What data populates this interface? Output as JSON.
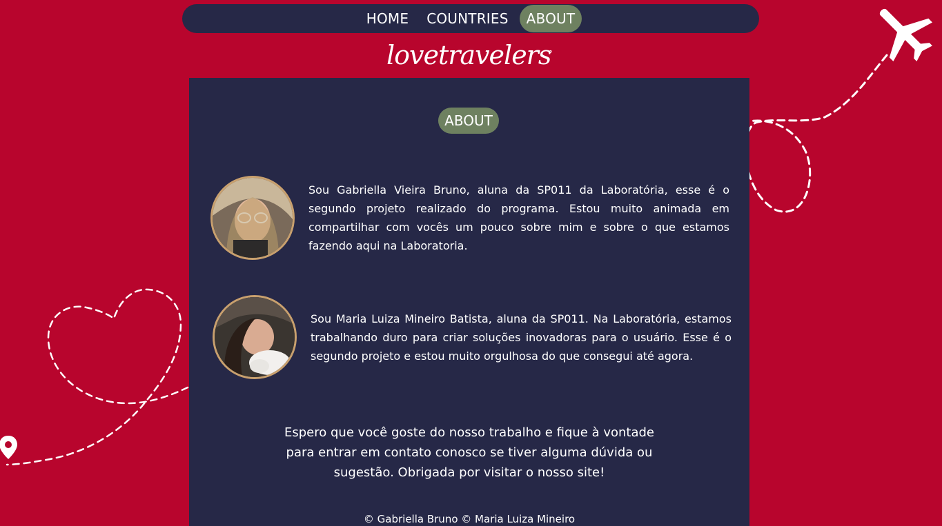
{
  "nav": {
    "items": [
      {
        "label": "HOME",
        "active": false
      },
      {
        "label": "COUNTRIES",
        "active": false
      },
      {
        "label": "ABOUT",
        "active": true
      }
    ]
  },
  "logo": {
    "text": "lovetravelers",
    "icon": "map-pin-plane-icon"
  },
  "about": {
    "title": "ABOUT",
    "profiles": [
      {
        "avatar": "avatar-photo",
        "bio": "Sou Gabriella Vieira Bruno, aluna da SP011 da Laboratória,  esse é o segundo projeto realizado do programa. Estou muito animada em compartilhar com vocês um pouco sobre mim e sobre o que estamos fazendo aqui na Laboratoria."
      },
      {
        "avatar": "avatar-photo",
        "bio": "Sou Maria Luiza Mineiro Batista, aluna da SP011. Na Laboratória, estamos trabalhando duro para criar soluções inovadoras para o usuário. Esse é o segundo projeto e estou muito orgulhosa do que consegui até agora."
      }
    ],
    "closing": "Espero que você goste do nosso trabalho e fique à vontade para entrar em contato conosco se tiver alguma dúvida ou sugestão. Obrigada por visitar o nosso site!"
  },
  "footer": {
    "text": "© Gabriella Bruno © Maria Luiza Mineiro"
  },
  "colors": {
    "background": "#b8052d",
    "panel": "#262847",
    "accent": "#6e8160",
    "avatar_border": "#c8a06e",
    "text": "#ffffff"
  },
  "decorations": [
    "airplane-icon",
    "dashed-flight-path",
    "location-pin-icon"
  ]
}
